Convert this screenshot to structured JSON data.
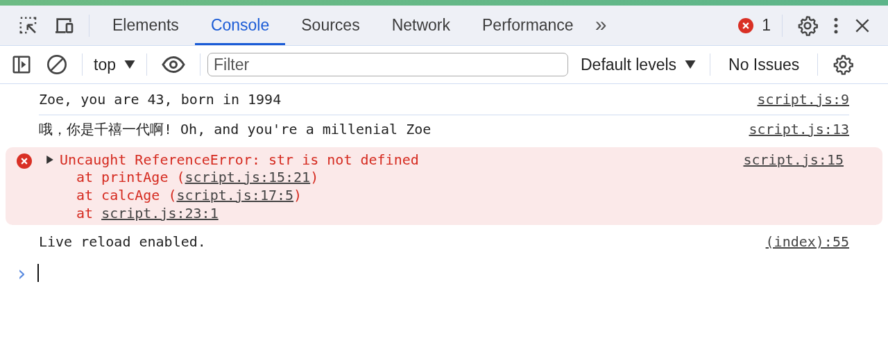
{
  "tabs": [
    {
      "label": "Elements",
      "selected": false
    },
    {
      "label": "Console",
      "selected": true
    },
    {
      "label": "Sources",
      "selected": false
    },
    {
      "label": "Network",
      "selected": false
    },
    {
      "label": "Performance",
      "selected": false
    }
  ],
  "more_tabs": "»",
  "error_count": "1",
  "toolbar": {
    "context": "top",
    "filter": {
      "placeholder": "Filter"
    },
    "levels": "Default levels",
    "issues": "No Issues"
  },
  "messages": [
    {
      "kind": "log",
      "text": "Zoe, you are 43, born in 1994",
      "source": "script.js:9"
    },
    {
      "kind": "log",
      "text": "哦，你是千禧一代啊! Oh, and you're a millenial Zoe",
      "source": "script.js:13"
    },
    {
      "kind": "error",
      "expanded": false,
      "text": "Uncaught ReferenceError: str is not defined",
      "source": "script.js:15",
      "frames": [
        {
          "prefix": "at printAge (",
          "link": "script.js:15:21",
          "suffix": ")"
        },
        {
          "prefix": "at calcAge (",
          "link": "script.js:17:5",
          "suffix": ")"
        },
        {
          "prefix": "at ",
          "link": "script.js:23:1"
        }
      ]
    },
    {
      "kind": "log",
      "text": "Live reload enabled.",
      "source": "(index):55"
    }
  ],
  "prompt": {
    "symbol": "›"
  }
}
